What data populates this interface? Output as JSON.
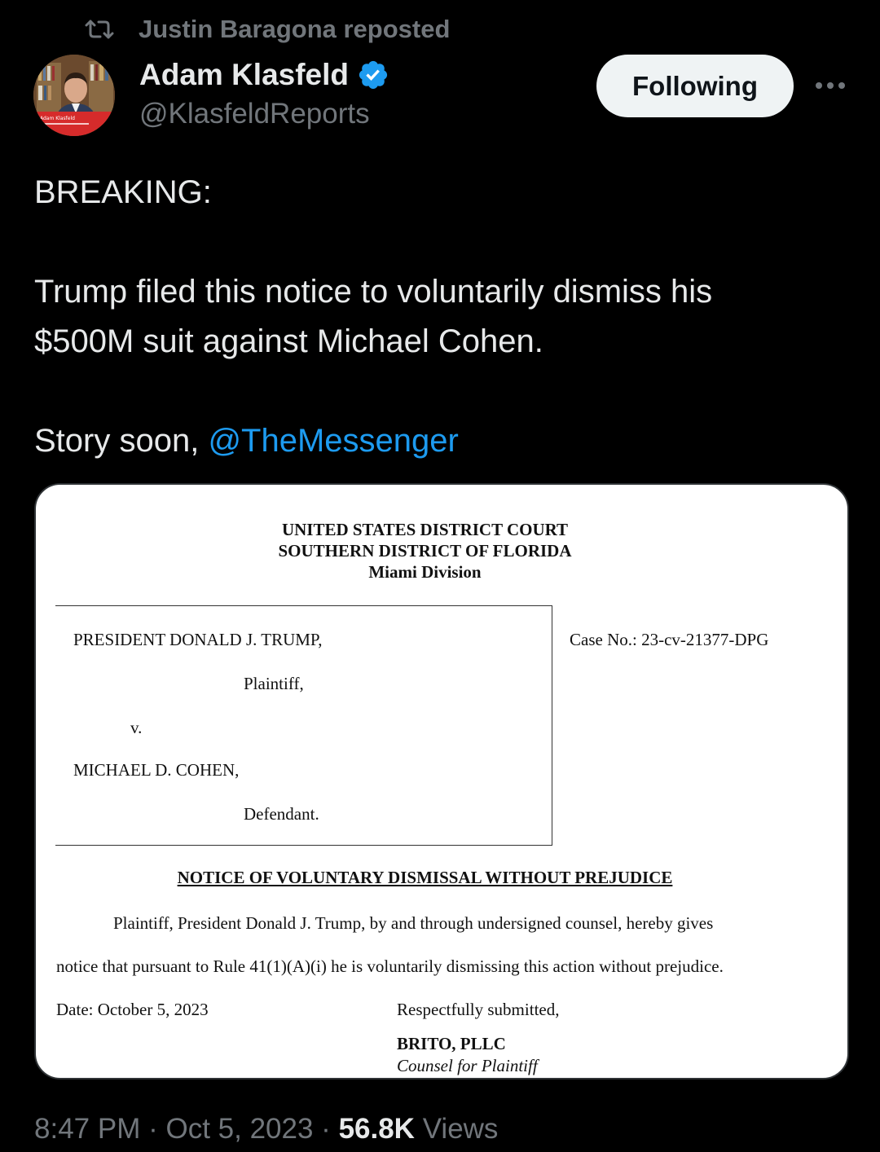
{
  "repost": {
    "icon": "repost-icon",
    "text": "Justin Baragona reposted"
  },
  "author": {
    "name": "Adam Klasfeld",
    "handle": "@KlasfeldReports",
    "verified_icon": "verified-badge-icon",
    "avatar_overlay_text": "Adam Klasfeld"
  },
  "actions": {
    "follow_label": "Following",
    "more_icon": "more-icon"
  },
  "tweet": {
    "line1": "BREAKING:",
    "line2a": "Trump filed this notice to voluntarily dismiss his",
    "line2b": "$500M suit against Michael Cohen.",
    "line3_prefix": "Story soon, ",
    "mention": "@TheMessenger"
  },
  "document": {
    "court_line1": "UNITED STATES DISTRICT COURT",
    "court_line2": "SOUTHERN DISTRICT OF FLORIDA",
    "court_line3": "Miami Division",
    "plaintiff_name": "PRESIDENT DONALD J. TRUMP,",
    "plaintiff_role": "Plaintiff,",
    "versus": "v.",
    "defendant_name": "MICHAEL D. COHEN,",
    "defendant_role": "Defendant.",
    "case_no": "Case No.: 23-cv-21377-DPG",
    "notice_title": "NOTICE OF VOLUNTARY DISMISSAL WITHOUT PREJUDICE",
    "body_line1": "Plaintiff, President Donald J. Trump, by and through undersigned counsel, hereby gives",
    "body_line2": "notice that pursuant to Rule 41(1)(A)(i) he is voluntarily dismissing this action without prejudice.",
    "date_line": "Date:  October 5, 2023",
    "closing": "Respectfully submitted,",
    "firm": "BRITO, PLLC",
    "counsel": "Counsel for Plaintiff"
  },
  "meta": {
    "time": "8:47 PM",
    "date": "Oct 5, 2023",
    "separator": "·",
    "views_count": "56.8K",
    "views_label": "Views"
  }
}
